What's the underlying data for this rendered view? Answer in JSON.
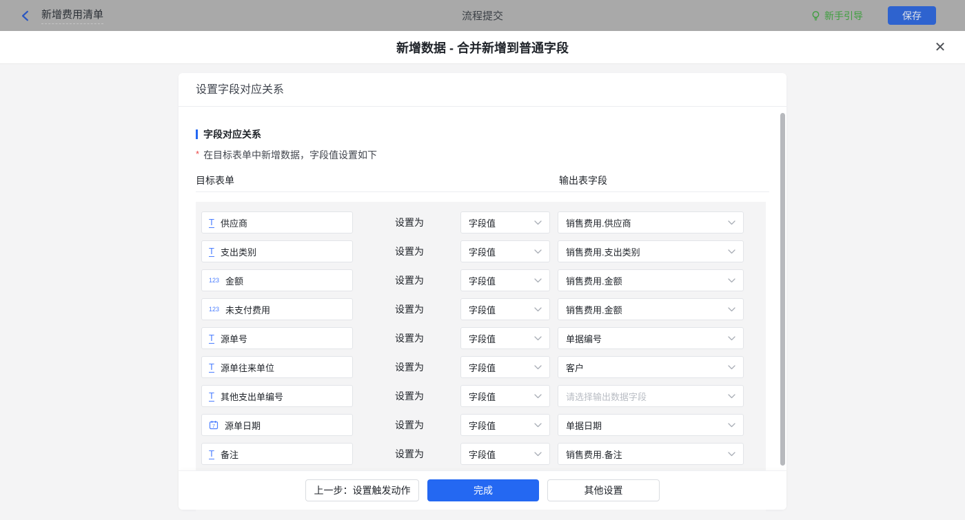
{
  "topbar": {
    "title": "新增费用清单",
    "center_title": "流程提交",
    "guide_label": "新手引导",
    "save_label": "保存"
  },
  "modal": {
    "title": "新增数据 - 合并新增到普通字段",
    "close_icon": "✕"
  },
  "panel": {
    "header": "设置字段对应关系",
    "section_title": "字段对应关系",
    "required_mark": "*",
    "description": "在目标表单中新增数据，字段值设置如下",
    "columns": {
      "left": "目标表单",
      "right": "输出表字段"
    },
    "set_as_label": "设置为",
    "rows": [
      {
        "icon": "text-field-icon",
        "field": "供应商",
        "mode": "字段值",
        "output": "销售费用.供应商",
        "is_placeholder": false
      },
      {
        "icon": "text-field-icon",
        "field": "支出类别",
        "mode": "字段值",
        "output": "销售费用.支出类别",
        "is_placeholder": false
      },
      {
        "icon": "number-field-icon",
        "field": "金额",
        "mode": "字段值",
        "output": "销售费用.金额",
        "is_placeholder": false
      },
      {
        "icon": "number-field-icon",
        "field": "未支付费用",
        "mode": "字段值",
        "output": "销售费用.金额",
        "is_placeholder": false
      },
      {
        "icon": "text-field-icon",
        "field": "源单号",
        "mode": "字段值",
        "output": "单据编号",
        "is_placeholder": false
      },
      {
        "icon": "text-field-icon",
        "field": "源单往来单位",
        "mode": "字段值",
        "output": "客户",
        "is_placeholder": false
      },
      {
        "icon": "text-field-icon",
        "field": "其他支出单编号",
        "mode": "字段值",
        "output": "请选择输出数据字段",
        "is_placeholder": true
      },
      {
        "icon": "date-field-icon",
        "field": "源单日期",
        "mode": "字段值",
        "output": "单据日期",
        "is_placeholder": false
      },
      {
        "icon": "text-field-icon",
        "field": "备注",
        "mode": "字段值",
        "output": "销售费用.备注",
        "is_placeholder": false
      }
    ],
    "has_partial_row": true,
    "footer": {
      "prev_label": "上一步：设置触发动作",
      "done_label": "完成",
      "other_label": "其他设置"
    }
  },
  "colors": {
    "primary_blue": "#2468f2",
    "field_icon_blue": "#4a7dff",
    "guide_green": "#3f9e3f",
    "required_red": "#eb4545",
    "topbar_gray": "#a9a9a9"
  }
}
